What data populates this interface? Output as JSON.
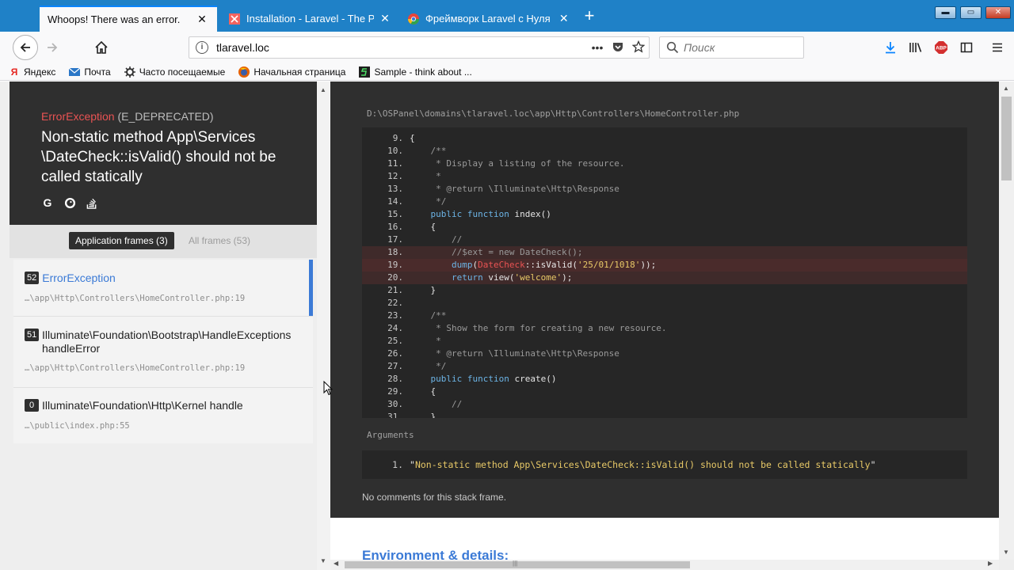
{
  "browser": {
    "tabs": [
      {
        "title": "Whoops! There was an error.",
        "active": true,
        "close": "✕"
      },
      {
        "title": "Installation - Laravel - The PHP",
        "active": false,
        "close": "✕"
      },
      {
        "title": "Фреймворк Laravel с Нуля до",
        "active": false,
        "close": "✕"
      }
    ],
    "new_tab": "+",
    "window_controls": {
      "minimize": "▬",
      "maximize": "▭",
      "close": "✕"
    },
    "url": "tlaravel.loc",
    "page_actions": "•••",
    "search_placeholder": "Поиск",
    "abp_label": "ABP",
    "bookmarks": [
      {
        "label": "Яндекс",
        "icon": "yandex-icon"
      },
      {
        "label": "Почта",
        "icon": "mail-icon"
      },
      {
        "label": "Часто посещаемые",
        "icon": "gear-icon"
      },
      {
        "label": "Начальная страница",
        "icon": "firefox-icon"
      },
      {
        "label": "Sample - think about ...",
        "icon": "sample-icon"
      }
    ]
  },
  "whoops": {
    "exception_class": "ErrorException",
    "exception_code": "(E_DEPRECATED)",
    "message": "Non-static method App\\Services \\DateCheck::isValid() should not be called statically",
    "frame_tabs": {
      "application": "Application frames (3)",
      "all": "All frames (53)"
    },
    "frames": [
      {
        "num": "52",
        "class": "ErrorException",
        "path": "…\\app\\Http\\Controllers\\HomeController.php:19",
        "selected": true
      },
      {
        "num": "51",
        "class": "Illuminate\\Foundation\\Bootstrap\\HandleExceptions handleError",
        "path": "…\\app\\Http\\Controllers\\HomeController.php:19",
        "selected": false
      },
      {
        "num": "0",
        "class": "Illuminate\\Foundation\\Http\\Kernel handle",
        "path": "…\\public\\index.php:55",
        "selected": false
      }
    ],
    "file_path": "D:\\OSPanel\\domains\\tlaravel.loc\\app\\Http\\Controllers\\HomeController.php",
    "code_lines": [
      {
        "n": "9.",
        "code": "{"
      },
      {
        "n": "10.",
        "code": "    /**"
      },
      {
        "n": "11.",
        "code": "     * Display a listing of the resource."
      },
      {
        "n": "12.",
        "code": "     *"
      },
      {
        "n": "13.",
        "code": "     * @return \\Illuminate\\Http\\Response"
      },
      {
        "n": "14.",
        "code": "     */"
      },
      {
        "n": "15.",
        "code": "    public function index()"
      },
      {
        "n": "16.",
        "code": "    {"
      },
      {
        "n": "17.",
        "code": "        //"
      },
      {
        "n": "18.",
        "code": "        //$ext = new DateCheck();"
      },
      {
        "n": "19.",
        "code": "        dump(DateCheck::isValid('25/01/1018'));"
      },
      {
        "n": "20.",
        "code": "        return view('welcome');"
      },
      {
        "n": "21.",
        "code": "    }"
      },
      {
        "n": "22.",
        "code": ""
      },
      {
        "n": "23.",
        "code": "    /**"
      },
      {
        "n": "24.",
        "code": "     * Show the form for creating a new resource."
      },
      {
        "n": "25.",
        "code": "     *"
      },
      {
        "n": "26.",
        "code": "     * @return \\Illuminate\\Http\\Response"
      },
      {
        "n": "27.",
        "code": "     */"
      },
      {
        "n": "28.",
        "code": "    public function create()"
      },
      {
        "n": "29.",
        "code": "    {"
      },
      {
        "n": "30.",
        "code": "        //"
      },
      {
        "n": "31.",
        "code": "    }"
      }
    ],
    "highlighted_lines": [
      "18.",
      "19.",
      "20."
    ],
    "arguments_label": "Arguments",
    "arguments": [
      {
        "n": "1.",
        "value": "Non-static method App\\Services\\DateCheck::isValid() should not be called statically"
      }
    ],
    "no_comments": "No comments for this stack frame.",
    "env_title": "Environment & details:"
  },
  "colors": {
    "tab_bar": "#1f81c7",
    "panel_dark": "#2f2f2f",
    "exception_red": "#e95353",
    "link_blue": "#3b7ad6",
    "string_yellow": "#e8c967"
  }
}
